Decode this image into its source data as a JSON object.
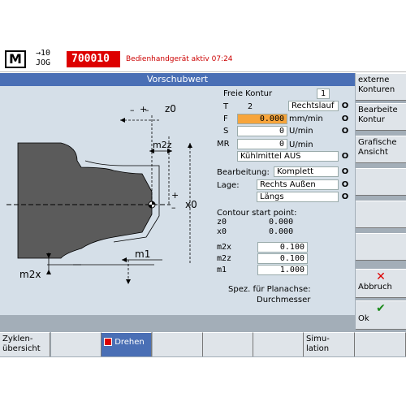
{
  "header": {
    "logo": "M",
    "mode_line1": "→10",
    "mode_line2": "JOG",
    "program": "700010",
    "alarm": "Bedienhandgerät aktiv 07:24"
  },
  "dialog": {
    "title": "Vorschubwert"
  },
  "graphic": {
    "labels": {
      "z0": "z0",
      "m2z": "m2z",
      "x0": "x0",
      "m1": "m1",
      "m2x": "m2x"
    }
  },
  "params": {
    "freie_kontur_label": "Freie Kontur",
    "freie_kontur_value": "1",
    "T_label": "T",
    "T_value": "2",
    "T_option": "Rechtslauf",
    "F_label": "F",
    "F_value": "0.000",
    "F_unit": "mm/min",
    "S_label": "S",
    "S_value": "0",
    "S_unit": "U/min",
    "MR_label": "MR",
    "MR_value": "0",
    "MR_unit": "U/min",
    "coolant": "Kühlmittel AUS",
    "bearbeitung_label": "Bearbeitung:",
    "bearbeitung_value": "Komplett",
    "lage_label": "Lage:",
    "lage_value": "Rechts Außen",
    "richtung_value": "Längs",
    "contour_start": "Contour start point:",
    "z0_label": "z0",
    "z0_value": "0.000",
    "x0_label": "x0",
    "x0_value": "0.000",
    "m2x_label": "m2x",
    "m2x_value": "0.100",
    "m2z_label": "m2z",
    "m2z_value": "0.100",
    "m1_label": "m1",
    "m1_value": "1.000",
    "spez_label": "Spez. für Planachse:",
    "spez_value": "Durchmesser",
    "toggle_icon": "O"
  },
  "right_softkeys": {
    "sk1": [
      "externe",
      "Konturen"
    ],
    "sk2": [
      "Bearbeite",
      "Kontur"
    ],
    "sk3": [
      "Grafische",
      "Ansicht"
    ],
    "abbruch": "Abbruch",
    "ok": "Ok"
  },
  "bottom_softkeys": {
    "zyklen": [
      "Zyklen-",
      "übersicht"
    ],
    "drehen": "Drehen",
    "simulation": [
      "Simu-",
      "lation"
    ]
  },
  "colors": {
    "title_bar": "#4a6fb5",
    "highlight": "#f7a53c",
    "program_bg": "#dd0000",
    "panel_bg": "#d5dfe8"
  }
}
